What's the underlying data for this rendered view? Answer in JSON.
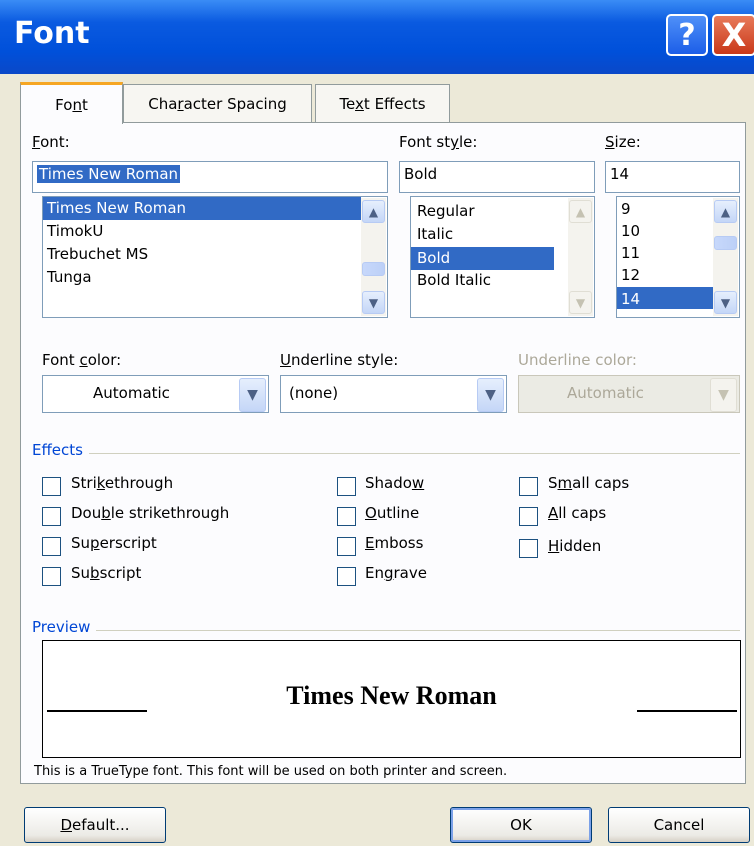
{
  "window": {
    "title": "Font",
    "help_icon": "?",
    "close_icon": "X"
  },
  "tabs": [
    {
      "label": "Font",
      "active": true
    },
    {
      "label": "Character Spacing",
      "active": false
    },
    {
      "label": "Text Effects",
      "active": false
    }
  ],
  "font": {
    "label": "Font:",
    "value": "Times New Roman",
    "items": [
      "Times New Roman",
      "TimokU",
      "Trebuchet MS",
      "Tunga"
    ],
    "selected": "Times New Roman"
  },
  "font_style": {
    "label": "Font style:",
    "value": "Bold",
    "items": [
      "Regular",
      "Italic",
      "Bold",
      "Bold Italic"
    ],
    "selected": "Bold"
  },
  "size": {
    "label": "Size:",
    "value": "14",
    "items": [
      "9",
      "10",
      "11",
      "12",
      "14"
    ],
    "selected": "14"
  },
  "font_color": {
    "label": "Font color:",
    "value": "Automatic"
  },
  "underline_style": {
    "label": "Underline style:",
    "value": "(none)"
  },
  "underline_color": {
    "label": "Underline color:",
    "value": "Automatic",
    "disabled": true
  },
  "effects": {
    "title": "Effects",
    "col1": [
      "Strikethrough",
      "Double strikethrough",
      "Superscript",
      "Subscript"
    ],
    "col2": [
      "Shadow",
      "Outline",
      "Emboss",
      "Engrave"
    ],
    "col3": [
      "Small caps",
      "All caps",
      "Hidden"
    ]
  },
  "preview": {
    "title": "Preview",
    "sample": "Times New Roman",
    "note": "This is a TrueType font. This font will be used on both printer and screen."
  },
  "buttons": {
    "default": "Default...",
    "ok": "OK",
    "cancel": "Cancel"
  },
  "colors": {
    "titlebar": "#0a5ae0",
    "selection": "#316ac5",
    "group_title": "#0046d5",
    "face": "#ece9d8"
  }
}
